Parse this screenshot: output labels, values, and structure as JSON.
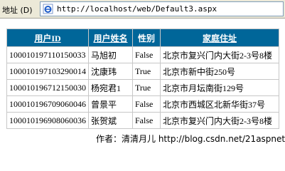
{
  "browser": {
    "address_label": "地址",
    "address_accesskey": "(D)",
    "url": "http://localhost/web/Default3.aspx"
  },
  "table": {
    "headers": [
      "用户ID",
      "用户姓名",
      "性别",
      "家庭住址"
    ],
    "rows": [
      [
        "100010197110150033",
        "马旭初",
        "False",
        "北京市复兴门内大街2-3号8楼"
      ],
      [
        "100010197103290014",
        "沈康玮",
        "True",
        "北京市新中街250号"
      ],
      [
        "100010196712150030",
        "杨宛君1",
        "True",
        "北京市月坛南街129号"
      ],
      [
        "100010196709060046",
        "曾景平",
        "False",
        "北京市西城区北新华街37号"
      ],
      [
        "100010196908060036",
        "张贺斌",
        "False",
        "北京市复兴门内大街2-3号8楼"
      ]
    ]
  },
  "footer": {
    "text": "作者：清清月儿 http://blog.csdn.net/21aspnet"
  }
}
